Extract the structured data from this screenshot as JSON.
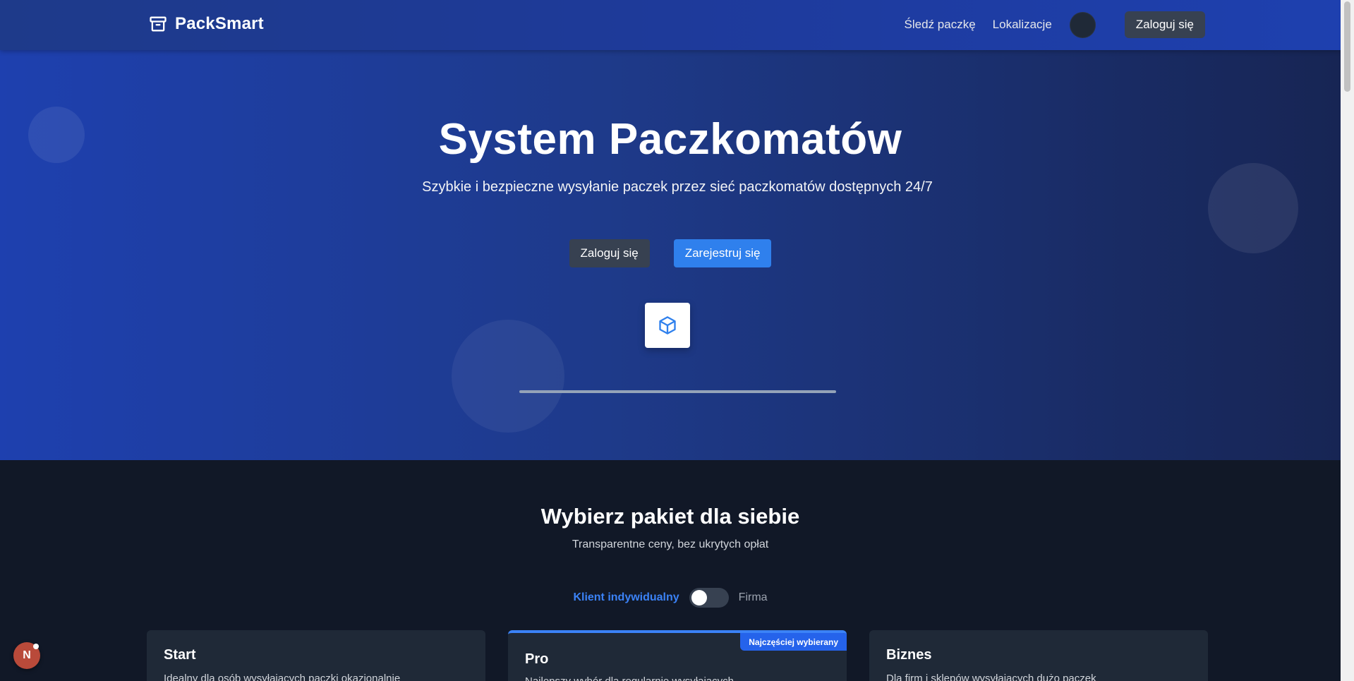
{
  "header": {
    "brand": "PackSmart",
    "nav": [
      {
        "label": "Śledź paczkę"
      },
      {
        "label": "Lokalizacje"
      }
    ],
    "login_label": "Zaloguj się"
  },
  "hero": {
    "title": "System Paczkomatów",
    "subtitle": "Szybkie i bezpieczne wysyłanie paczek przez sieć paczkomatów dostępnych 24/7",
    "login_label": "Zaloguj się",
    "register_label": "Zarejestruj się",
    "progress": 1.0
  },
  "pricing": {
    "title": "Wybierz pakiet dla siebie",
    "subtitle": "Transparentne ceny, bez ukrytych opłat",
    "toggle_left": "Klient indywidualny",
    "toggle_right": "Firma",
    "cards": [
      {
        "title": "Start",
        "desc": "Idealny dla osób wysyłających paczki okazjonalnie"
      },
      {
        "title": "Pro",
        "desc": "Najlepszy wybór dla regularnie wysyłających",
        "badge": "Najczęściej wybierany"
      },
      {
        "title": "Biznes",
        "desc": "Dla firm i sklepów wysyłających dużo paczek"
      }
    ]
  },
  "dev_badge": {
    "label": "N"
  },
  "colors": {
    "accent": "#3b82f6",
    "header_bg": "#1e3a8a",
    "page_bg": "#111827",
    "card_bg": "#1f2937"
  }
}
